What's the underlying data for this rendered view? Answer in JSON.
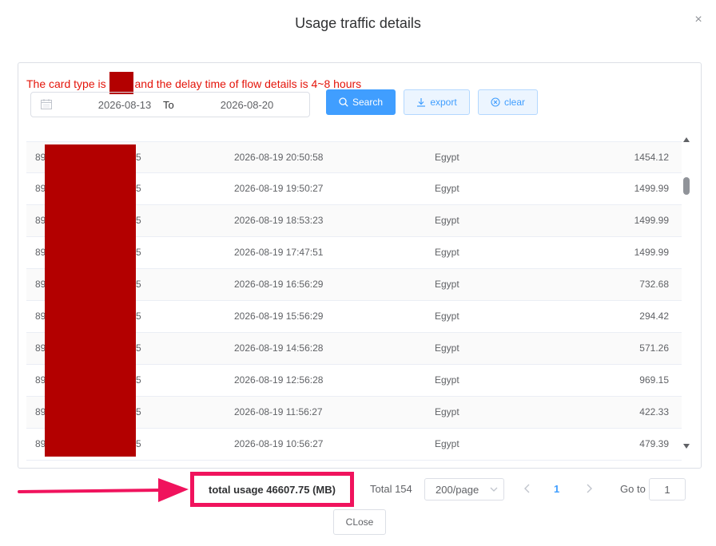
{
  "dialog": {
    "title": "Usage traffic details",
    "close_glyph": "×"
  },
  "notice": {
    "prefix": "The card type is",
    "suffix": "and the delay time of flow details is 4~8 hours",
    "color": "#e4140a"
  },
  "filter": {
    "start_date": "2026-08-13",
    "separator": "To",
    "end_date": "2026-08-20",
    "search_label": "Search",
    "export_label": "export",
    "clear_label": "clear"
  },
  "table": {
    "rows": [
      {
        "iccid_head": "89",
        "iccid_tail": "5",
        "time": "2026-08-19 20:50:58",
        "country": "Egypt",
        "usage": "1454.12"
      },
      {
        "iccid_head": "89",
        "iccid_tail": "5",
        "time": "2026-08-19 19:50:27",
        "country": "Egypt",
        "usage": "1499.99"
      },
      {
        "iccid_head": "89",
        "iccid_tail": "5",
        "time": "2026-08-19 18:53:23",
        "country": "Egypt",
        "usage": "1499.99"
      },
      {
        "iccid_head": "89",
        "iccid_tail": "5",
        "time": "2026-08-19 17:47:51",
        "country": "Egypt",
        "usage": "1499.99"
      },
      {
        "iccid_head": "89",
        "iccid_tail": "5",
        "time": "2026-08-19 16:56:29",
        "country": "Egypt",
        "usage": "732.68"
      },
      {
        "iccid_head": "89",
        "iccid_tail": "5",
        "time": "2026-08-19 15:56:29",
        "country": "Egypt",
        "usage": "294.42"
      },
      {
        "iccid_head": "89",
        "iccid_tail": "5",
        "time": "2026-08-19 14:56:28",
        "country": "Egypt",
        "usage": "571.26"
      },
      {
        "iccid_head": "89",
        "iccid_tail": "5",
        "time": "2026-08-19 12:56:28",
        "country": "Egypt",
        "usage": "969.15"
      },
      {
        "iccid_head": "89",
        "iccid_tail": "5",
        "time": "2026-08-19 11:56:27",
        "country": "Egypt",
        "usage": "422.33"
      },
      {
        "iccid_head": "89",
        "iccid_tail": "5",
        "time": "2026-08-19 10:56:27",
        "country": "Egypt",
        "usage": "479.39"
      }
    ]
  },
  "summary": {
    "total_usage": "total usage 46607.75 (MB)",
    "highlight_color": "#f0135d"
  },
  "pagination": {
    "total": "Total 154",
    "page_size": "200/page",
    "current_page": "1",
    "goto_label": "Go to",
    "goto_value": "1"
  },
  "footer": {
    "close_label": "CLose"
  },
  "colors": {
    "primary": "#409eff",
    "redaction": "#b30000",
    "text": "#606266"
  }
}
